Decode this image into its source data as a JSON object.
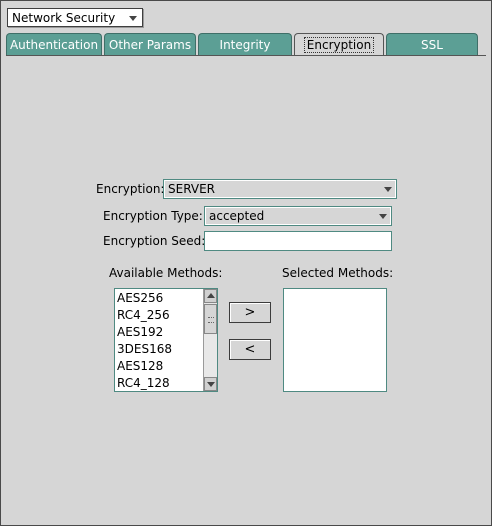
{
  "top_select": {
    "value": "Network Security"
  },
  "tabs": [
    {
      "label": "Authentication"
    },
    {
      "label": "Other Params"
    },
    {
      "label": "Integrity"
    },
    {
      "label": "Encryption",
      "active": true
    },
    {
      "label": "SSL"
    }
  ],
  "form": {
    "encryption_label": "Encryption:",
    "encryption_value": "SERVER",
    "type_label": "Encryption Type:",
    "type_value": "accepted",
    "seed_label": "Encryption Seed:",
    "seed_value": ""
  },
  "methods": {
    "available_label": "Available Methods:",
    "selected_label": "Selected Methods:",
    "available": [
      "AES256",
      "RC4_256",
      "AES192",
      "3DES168",
      "AES128",
      "RC4_128"
    ],
    "selected": [],
    "add_label": ">",
    "remove_label": "<"
  },
  "colors": {
    "accent": "#5b9a8f",
    "panel": "#d6d6d6"
  }
}
